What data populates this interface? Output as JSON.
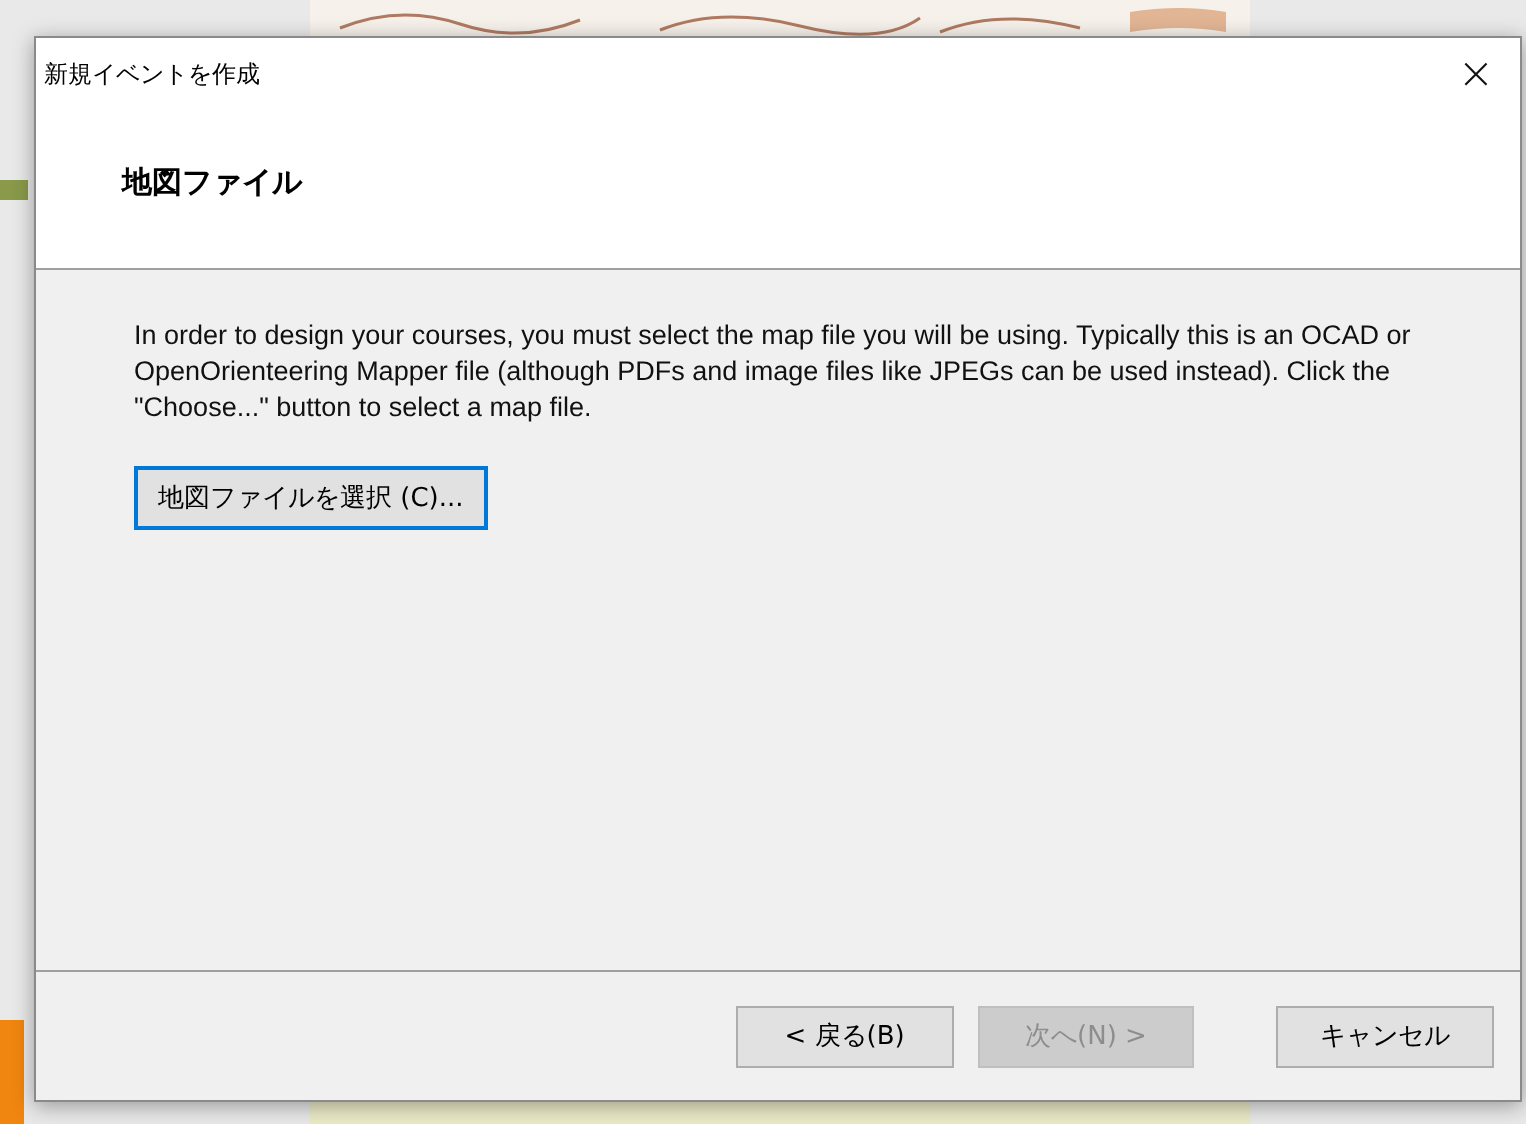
{
  "window": {
    "title": "新規イベントを作成",
    "close": "×"
  },
  "header": {
    "title": "地図ファイル"
  },
  "description": "In order to design your courses, you must select the map file you will be using. Typically this is an OCAD or OpenOrienteering Mapper file (although PDFs and image files like JPEGs can be used instead). Click the \"Choose...\" button to select a map file.",
  "choose_button": {
    "label": "地図ファイルを選択 (C)...",
    "focused": true
  },
  "buttons": [
    {
      "label": "< 戻る(B)",
      "disabled": false
    },
    {
      "label": "次へ(N) >",
      "disabled": true
    },
    {
      "label": "キャンセル",
      "disabled": false
    }
  ]
}
